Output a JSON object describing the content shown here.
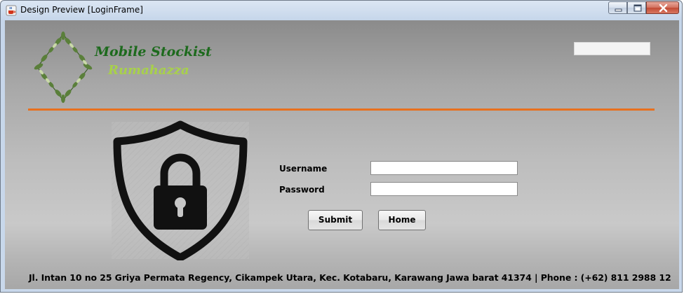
{
  "window": {
    "title": "Design Preview [LoginFrame]",
    "icon": "java-cup-icon",
    "controls": [
      "minimize-icon",
      "maximize-icon",
      "close-icon"
    ]
  },
  "header": {
    "brand_line1": "Mobile Stockist",
    "brand_line2": "Rumahazza",
    "logo": "leaf-wreath-icon",
    "top_field_value": "",
    "divider_color": "#e8701e"
  },
  "login": {
    "illustration": "shield-lock-icon",
    "username_label": "Username",
    "username_value": "",
    "password_label": "Password",
    "password_value": "",
    "submit_label": "Submit",
    "home_label": "Home"
  },
  "footer": {
    "address": "Jl. Intan 10 no 25 Griya Permata Regency, Cikampek Utara, Kec. Kotabaru, Karawang Jawa barat 41374 | Phone : (+62) 811 2988 12"
  },
  "colors": {
    "brand_dark_green": "#1d6a1d",
    "brand_light_green": "#a8d14a",
    "accent_orange": "#e8701e"
  }
}
